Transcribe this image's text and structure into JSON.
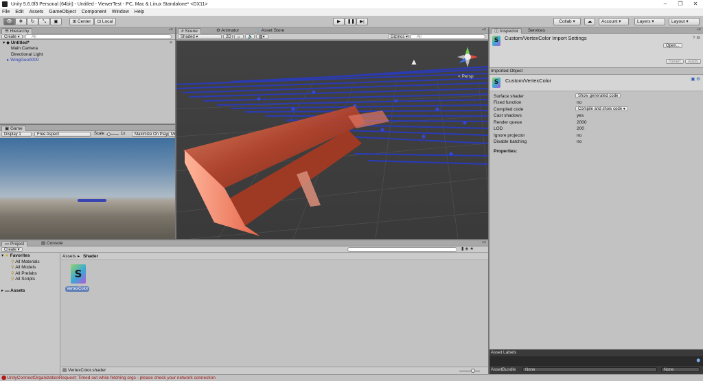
{
  "window": {
    "title": "Unity 5.6.0f3 Personal (64bit) - Untitled - ViewerTest - PC, Mac & Linux Standalone* <DX11>",
    "minimize": "–",
    "maximize": "❐",
    "close": "✕"
  },
  "menu": [
    "File",
    "Edit",
    "Assets",
    "GameObject",
    "Component",
    "Window",
    "Help"
  ],
  "toolbar": {
    "pivot_center": "Center",
    "pivot_local": "Local",
    "collab": "Collab ▾",
    "account": "Account",
    "layers": "Layers",
    "layout": "Layout"
  },
  "hierarchy": {
    "tab": "Hierarchy",
    "create": "Create ▾",
    "search_placeholder": "All",
    "scene": "Untitled*",
    "items": [
      "Main Camera",
      "Directional Light",
      "WingGeo0000"
    ]
  },
  "game": {
    "tab": "Game",
    "display": "Display 1",
    "aspect": "Free Aspect",
    "scale_label": "Scale",
    "scale_value": "1x",
    "maximize": "Maximize On Play",
    "mute": "Mu"
  },
  "scene_view": {
    "tabs": [
      "Scene",
      "Animator",
      "Asset Store"
    ],
    "shading": "Shaded",
    "mode_2d": "2D",
    "gizmos": "Gizmos ▾",
    "search_placeholder": "All",
    "persp": "< Persp"
  },
  "project": {
    "tabs": [
      "Project",
      "Console"
    ],
    "create": "Create ▾",
    "favorites_label": "Favorites",
    "favorites": [
      "All Materials",
      "All Models",
      "All Prefabs",
      "All Scripts"
    ],
    "assets_label": "Assets",
    "breadcrumb_root": "Assets",
    "breadcrumb_current": "Shader",
    "asset_name": "VertexColor",
    "selected_path": "VertexColor.shader"
  },
  "inspector": {
    "tabs": [
      "Inspector",
      "Services"
    ],
    "header_title": "Custom/VertexColor Import Settings",
    "open_button": "Open...",
    "revert_button": "Revert",
    "apply_button": "Apply",
    "section_title": "Imported Object",
    "object_name": "Custom/VertexColor",
    "properties": [
      {
        "key": "Surface shader",
        "value": ""
      },
      {
        "key": "Fixed function",
        "value": "no"
      },
      {
        "key": "Compiled code",
        "value": ""
      },
      {
        "key": "Cast shadows",
        "value": "yes"
      },
      {
        "key": "Render queue",
        "value": "2000"
      },
      {
        "key": "LOD",
        "value": "200"
      },
      {
        "key": "Ignore projector",
        "value": "no"
      },
      {
        "key": "Disable batching",
        "value": "no"
      }
    ],
    "show_generated": "Show generated code",
    "compile_show": "Compile and show code ▾",
    "properties_label": "Properties:",
    "asset_labels": "Asset Labels",
    "asset_bundle": "AssetBundle",
    "bundle_name": "None",
    "bundle_variant": "None"
  },
  "status": {
    "message": "UnityConnectOrganizationRequest: Timed out while fetching orgs - please check your network connection"
  }
}
